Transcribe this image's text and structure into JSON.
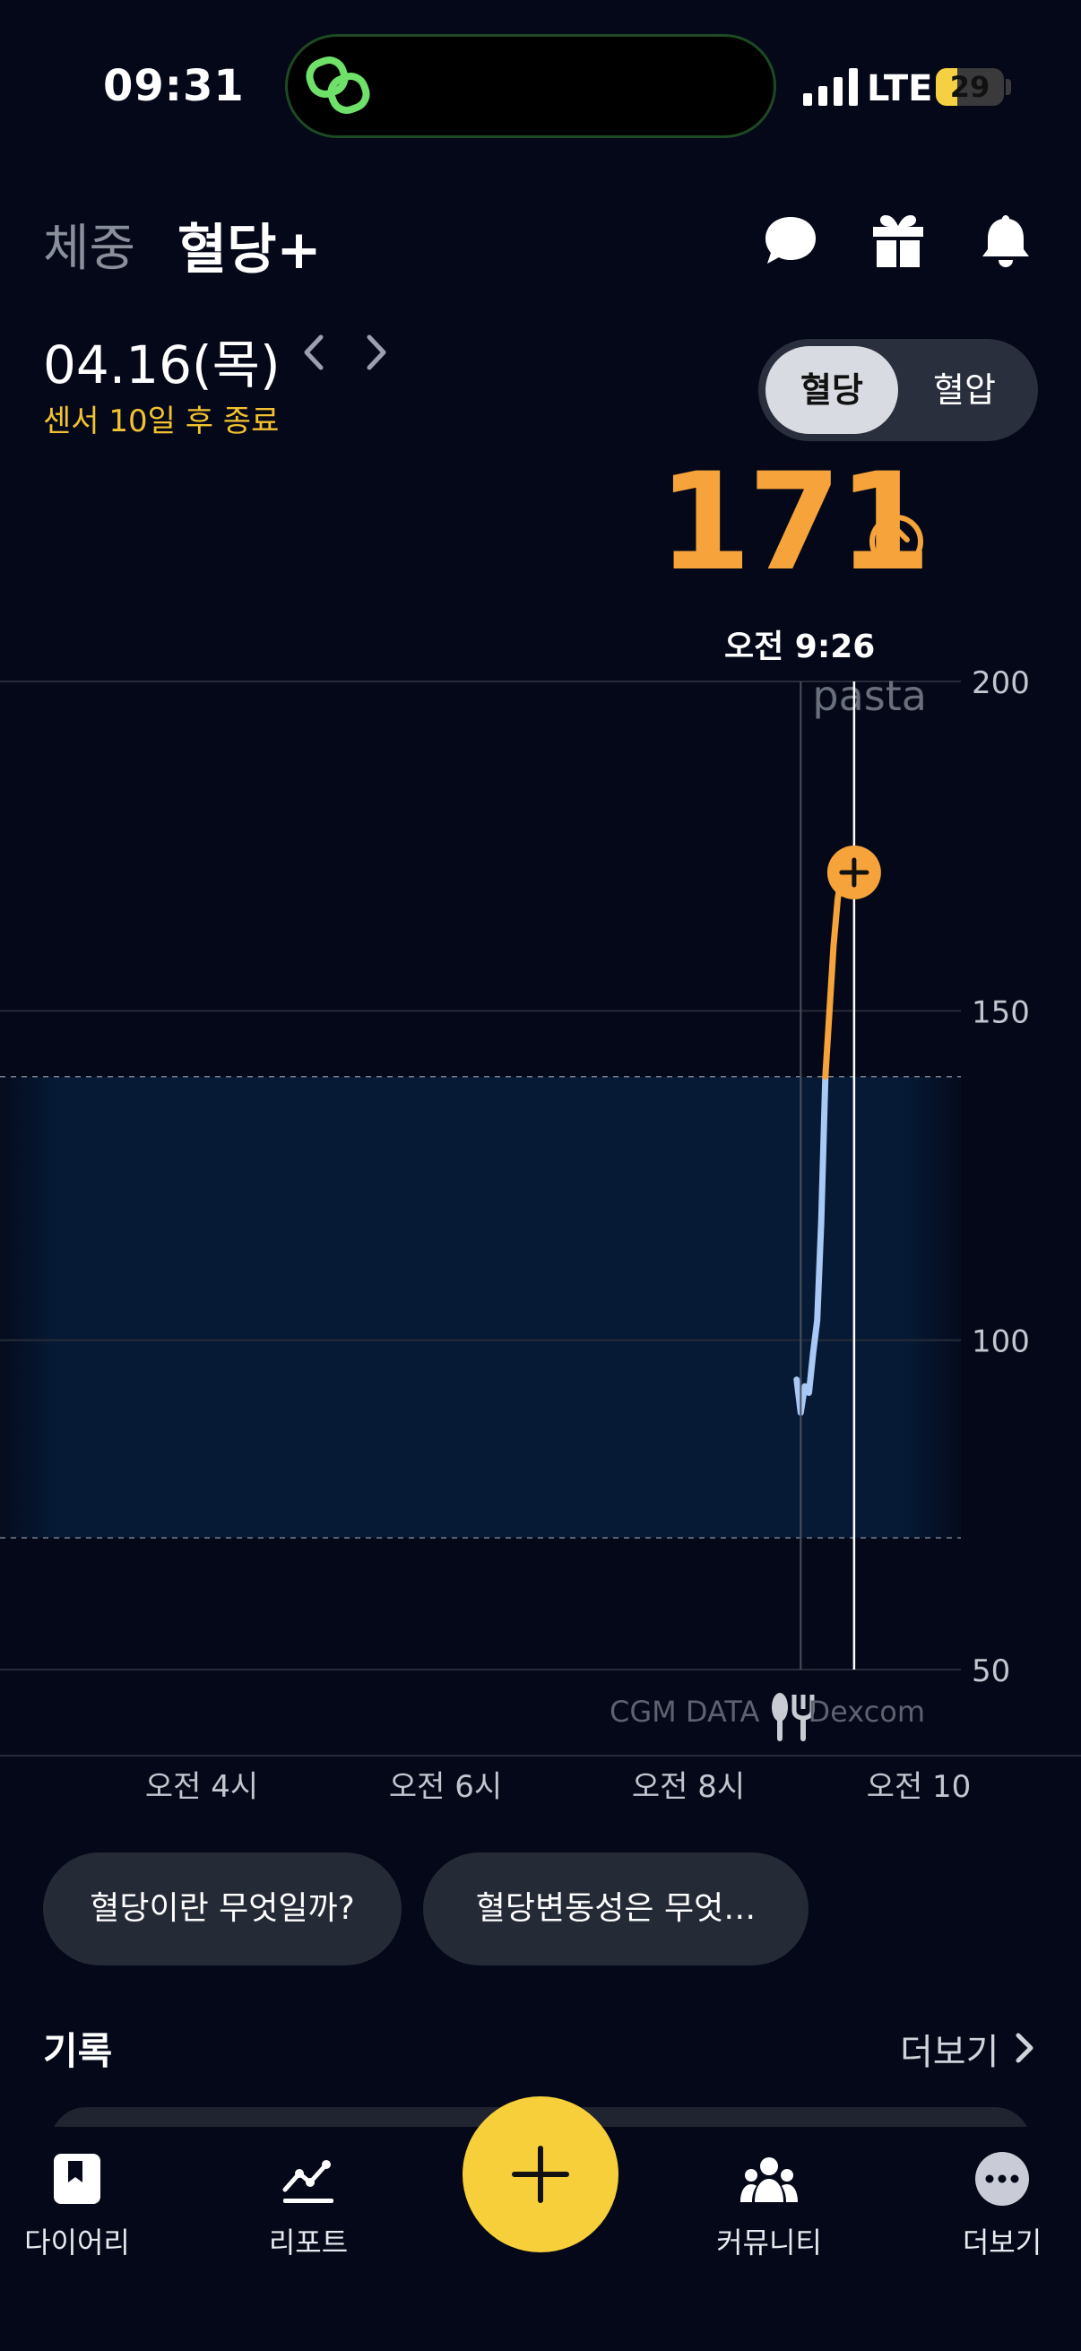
{
  "status_bar": {
    "time": "09:31",
    "network": "LTE",
    "battery": "29"
  },
  "header": {
    "tabs": [
      {
        "label": "체중",
        "active": false
      },
      {
        "label": "혈당+",
        "active": true
      }
    ],
    "icons": [
      "chat-bubble-icon",
      "gift-icon",
      "bell-icon"
    ]
  },
  "date_bar": {
    "date": "04.16(목)",
    "sensor_note": "센서 10일 후 종료",
    "toggle": {
      "selected": "혈당",
      "other": "혈압"
    }
  },
  "reading": {
    "value": "171",
    "trend": "rising",
    "time": "오전 9:26"
  },
  "chart_data": {
    "type": "line",
    "y_ticks": [
      "200",
      "150",
      "100",
      "50"
    ],
    "ylim": [
      50,
      200
    ],
    "x_ticks": [
      "오전 4시",
      "오전 6시",
      "오전 8시",
      "오전 10"
    ],
    "target_range": [
      70,
      140
    ],
    "series": [
      {
        "x": [
          "08:58",
          "09:00",
          "09:02",
          "09:04",
          "09:06",
          "09:08",
          "09:10",
          "09:12",
          "09:14",
          "09:16",
          "09:18",
          "09:20",
          "09:22",
          "09:24",
          "09:26"
        ],
        "values": [
          94,
          89,
          93,
          92,
          98,
          103,
          118,
          140,
          150,
          160,
          167,
          171,
          171,
          171,
          171
        ]
      }
    ],
    "cursor_time": "09:26",
    "meal_marker_time": "09:00",
    "watermark": "pasta",
    "source_text": "CGM DATA",
    "source_brand": "Dexcom",
    "colors": {
      "in_range": "#a8c8f5",
      "high": "#f5a33a",
      "range_fill": "#061a35"
    }
  },
  "chips": [
    "혈당이란 무엇일까?",
    "혈당변동성은 무엇…"
  ],
  "records": {
    "title": "기록",
    "more": "더보기"
  },
  "bottom_nav": {
    "items": [
      {
        "label": "다이어리",
        "icon": "diary-icon"
      },
      {
        "label": "리포트",
        "icon": "report-chart-icon"
      },
      {
        "label": "커뮤니티",
        "icon": "community-people-icon"
      },
      {
        "label": "더보기",
        "icon": "more-dots-icon"
      }
    ],
    "fab_icon": "plus-icon",
    "accent": "#f7cf3a"
  }
}
